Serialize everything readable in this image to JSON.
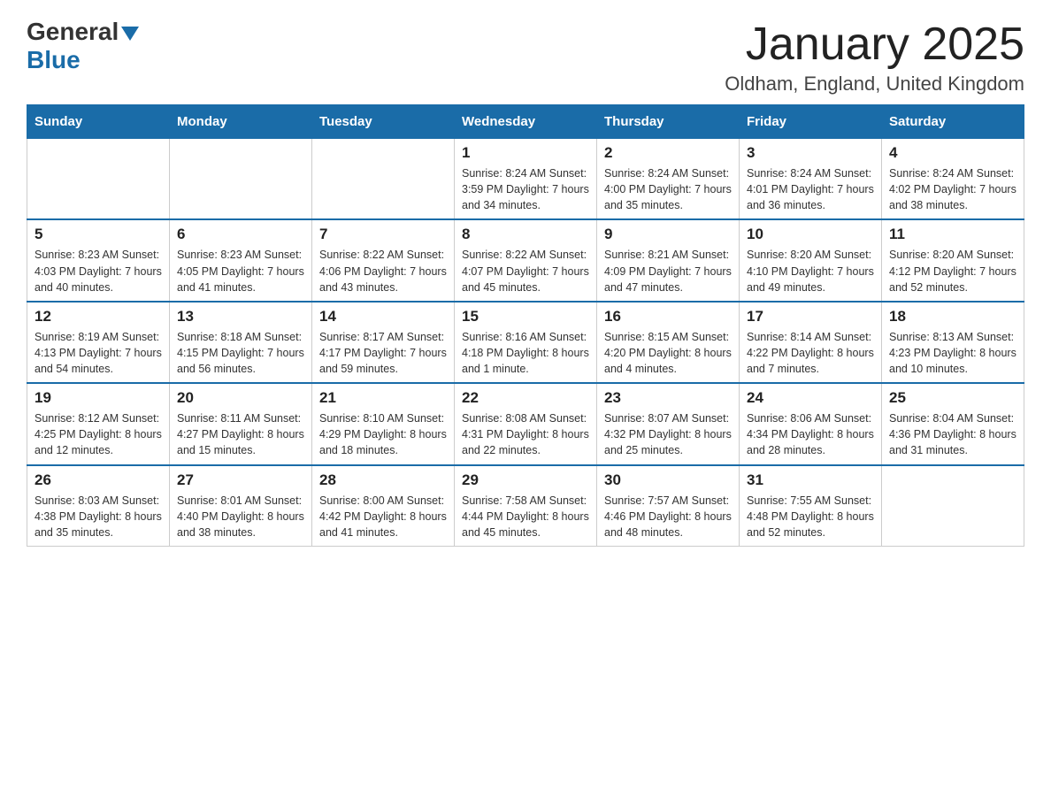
{
  "header": {
    "logo_general": "General",
    "logo_blue": "Blue",
    "title": "January 2025",
    "subtitle": "Oldham, England, United Kingdom"
  },
  "weekdays": [
    "Sunday",
    "Monday",
    "Tuesday",
    "Wednesday",
    "Thursday",
    "Friday",
    "Saturday"
  ],
  "weeks": [
    [
      {
        "day": "",
        "info": ""
      },
      {
        "day": "",
        "info": ""
      },
      {
        "day": "",
        "info": ""
      },
      {
        "day": "1",
        "info": "Sunrise: 8:24 AM\nSunset: 3:59 PM\nDaylight: 7 hours\nand 34 minutes."
      },
      {
        "day": "2",
        "info": "Sunrise: 8:24 AM\nSunset: 4:00 PM\nDaylight: 7 hours\nand 35 minutes."
      },
      {
        "day": "3",
        "info": "Sunrise: 8:24 AM\nSunset: 4:01 PM\nDaylight: 7 hours\nand 36 minutes."
      },
      {
        "day": "4",
        "info": "Sunrise: 8:24 AM\nSunset: 4:02 PM\nDaylight: 7 hours\nand 38 minutes."
      }
    ],
    [
      {
        "day": "5",
        "info": "Sunrise: 8:23 AM\nSunset: 4:03 PM\nDaylight: 7 hours\nand 40 minutes."
      },
      {
        "day": "6",
        "info": "Sunrise: 8:23 AM\nSunset: 4:05 PM\nDaylight: 7 hours\nand 41 minutes."
      },
      {
        "day": "7",
        "info": "Sunrise: 8:22 AM\nSunset: 4:06 PM\nDaylight: 7 hours\nand 43 minutes."
      },
      {
        "day": "8",
        "info": "Sunrise: 8:22 AM\nSunset: 4:07 PM\nDaylight: 7 hours\nand 45 minutes."
      },
      {
        "day": "9",
        "info": "Sunrise: 8:21 AM\nSunset: 4:09 PM\nDaylight: 7 hours\nand 47 minutes."
      },
      {
        "day": "10",
        "info": "Sunrise: 8:20 AM\nSunset: 4:10 PM\nDaylight: 7 hours\nand 49 minutes."
      },
      {
        "day": "11",
        "info": "Sunrise: 8:20 AM\nSunset: 4:12 PM\nDaylight: 7 hours\nand 52 minutes."
      }
    ],
    [
      {
        "day": "12",
        "info": "Sunrise: 8:19 AM\nSunset: 4:13 PM\nDaylight: 7 hours\nand 54 minutes."
      },
      {
        "day": "13",
        "info": "Sunrise: 8:18 AM\nSunset: 4:15 PM\nDaylight: 7 hours\nand 56 minutes."
      },
      {
        "day": "14",
        "info": "Sunrise: 8:17 AM\nSunset: 4:17 PM\nDaylight: 7 hours\nand 59 minutes."
      },
      {
        "day": "15",
        "info": "Sunrise: 8:16 AM\nSunset: 4:18 PM\nDaylight: 8 hours\nand 1 minute."
      },
      {
        "day": "16",
        "info": "Sunrise: 8:15 AM\nSunset: 4:20 PM\nDaylight: 8 hours\nand 4 minutes."
      },
      {
        "day": "17",
        "info": "Sunrise: 8:14 AM\nSunset: 4:22 PM\nDaylight: 8 hours\nand 7 minutes."
      },
      {
        "day": "18",
        "info": "Sunrise: 8:13 AM\nSunset: 4:23 PM\nDaylight: 8 hours\nand 10 minutes."
      }
    ],
    [
      {
        "day": "19",
        "info": "Sunrise: 8:12 AM\nSunset: 4:25 PM\nDaylight: 8 hours\nand 12 minutes."
      },
      {
        "day": "20",
        "info": "Sunrise: 8:11 AM\nSunset: 4:27 PM\nDaylight: 8 hours\nand 15 minutes."
      },
      {
        "day": "21",
        "info": "Sunrise: 8:10 AM\nSunset: 4:29 PM\nDaylight: 8 hours\nand 18 minutes."
      },
      {
        "day": "22",
        "info": "Sunrise: 8:08 AM\nSunset: 4:31 PM\nDaylight: 8 hours\nand 22 minutes."
      },
      {
        "day": "23",
        "info": "Sunrise: 8:07 AM\nSunset: 4:32 PM\nDaylight: 8 hours\nand 25 minutes."
      },
      {
        "day": "24",
        "info": "Sunrise: 8:06 AM\nSunset: 4:34 PM\nDaylight: 8 hours\nand 28 minutes."
      },
      {
        "day": "25",
        "info": "Sunrise: 8:04 AM\nSunset: 4:36 PM\nDaylight: 8 hours\nand 31 minutes."
      }
    ],
    [
      {
        "day": "26",
        "info": "Sunrise: 8:03 AM\nSunset: 4:38 PM\nDaylight: 8 hours\nand 35 minutes."
      },
      {
        "day": "27",
        "info": "Sunrise: 8:01 AM\nSunset: 4:40 PM\nDaylight: 8 hours\nand 38 minutes."
      },
      {
        "day": "28",
        "info": "Sunrise: 8:00 AM\nSunset: 4:42 PM\nDaylight: 8 hours\nand 41 minutes."
      },
      {
        "day": "29",
        "info": "Sunrise: 7:58 AM\nSunset: 4:44 PM\nDaylight: 8 hours\nand 45 minutes."
      },
      {
        "day": "30",
        "info": "Sunrise: 7:57 AM\nSunset: 4:46 PM\nDaylight: 8 hours\nand 48 minutes."
      },
      {
        "day": "31",
        "info": "Sunrise: 7:55 AM\nSunset: 4:48 PM\nDaylight: 8 hours\nand 52 minutes."
      },
      {
        "day": "",
        "info": ""
      }
    ]
  ]
}
